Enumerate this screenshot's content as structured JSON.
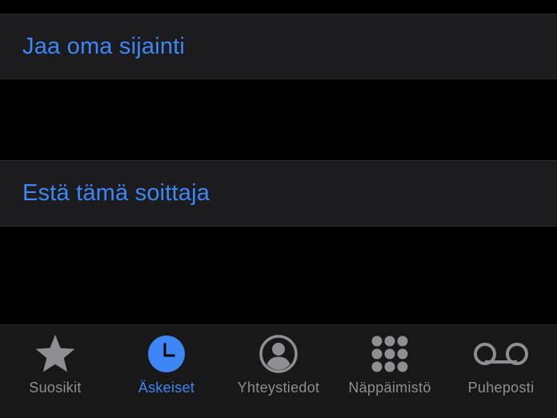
{
  "colors": {
    "accent": "#3e86f5",
    "tab_inactive": "#8e8e93",
    "cell_background": "#1c1c1e",
    "screen_background": "#000000",
    "tabbar_background": "#181818"
  },
  "actions": {
    "share_location": "Jaa oma sijainti",
    "block_caller": "Estä tämä soittaja"
  },
  "tabbar": {
    "selected": "recents",
    "tabs": [
      {
        "id": "favorites",
        "label": "Suosikit",
        "icon": "star-icon"
      },
      {
        "id": "recents",
        "label": "Äskeiset",
        "icon": "clock-icon"
      },
      {
        "id": "contacts",
        "label": "Yhteystiedot",
        "icon": "person-circle-icon"
      },
      {
        "id": "keypad",
        "label": "Näppäimistö",
        "icon": "keypad-icon"
      },
      {
        "id": "voicemail",
        "label": "Puheposti",
        "icon": "voicemail-icon"
      }
    ]
  }
}
